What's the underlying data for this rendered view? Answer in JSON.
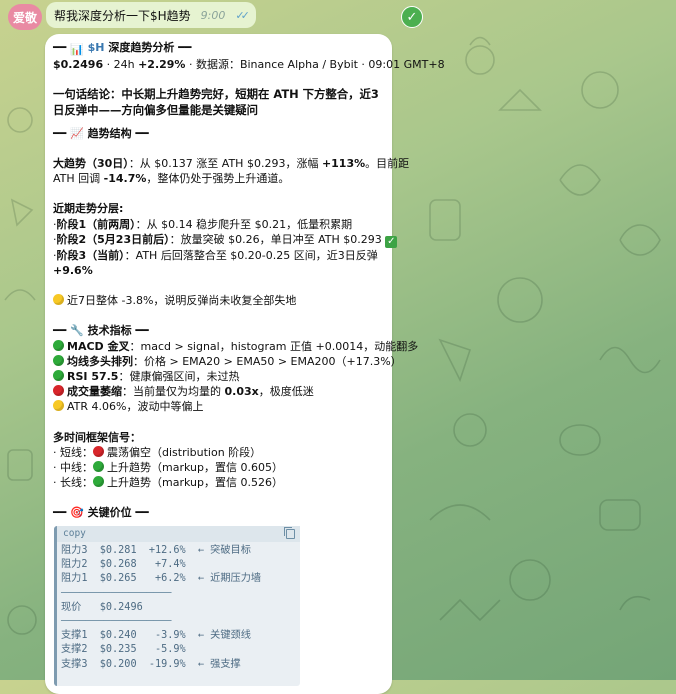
{
  "user_message": {
    "avatar_text": "爱敬",
    "text": "帮我深度分析一下$H趋势",
    "time": "9:00",
    "ticks": "✓✓"
  },
  "bot_message": {
    "title_prefix": "━━ ",
    "title_ticker": "$H",
    "title_text": " 深度趋势分析 ━━",
    "price_line": {
      "price": "$0.2496",
      "rest": " · 24h ",
      "change": "+2.29%",
      "tail": " · 数据源：Binance Alpha / Bybit · 09:01 GMT+8"
    },
    "conclusion": "一句话结论：中长期上升趋势完好，短期在 ATH 下方整合，近3日反弹中——方向偏多但量能是关键疑问",
    "sections": {
      "structure": "━━ 📈 趋势结构 ━━",
      "indicators": "━━ 🔧 技术指标 ━━",
      "key_levels": "━━ 🎯 关键价位 ━━"
    },
    "big_trend": {
      "label": "大趋势（30日）",
      "text1": "：从 $0.137 涨至 ATH $0.293，涨幅 ",
      "pct": "+113%",
      "text2": "。目前距",
      "text3": "ATH 回调 ",
      "pullback": "-14.7%",
      "text4": "，整体仍处于强势上升通道。"
    },
    "recent": {
      "label": "近期走势分层:",
      "stage1_label": "阶段1（前两周）",
      "stage1_text": "：从 $0.14 稳步爬升至 $0.21，低量积累期",
      "stage2_label": "阶段2（5月23日前后）",
      "stage2_text": "：放量突破 $0.26，单日冲至 ATH $0.293",
      "stage3_label": "阶段3（当前）",
      "stage3_text": "：ATH 后回落整合至 $0.20-0.25 区间，近3日反弹",
      "stage3_pct": "+9.6%",
      "bullet": "·"
    },
    "seven_day": "近7日整体 -3.8%，说明反弹尚未收复全部失地",
    "indicators": [
      {
        "color": "green",
        "label": "MACD 金叉",
        "text": "：macd > signal，histogram 正值 +0.0014，动能翻多"
      },
      {
        "color": "green",
        "label": "均线多头排列",
        "text": "：价格 > EMA20 > EMA50 > EMA200（+17.3%）"
      },
      {
        "color": "green",
        "label": "RSI 57.5",
        "text": "：健康偏强区间，未过热"
      },
      {
        "color": "red",
        "label": "成交量萎缩",
        "text": "：当前量仅为均量的 ",
        "bold2": "0.03x",
        "text2": "，极度低迷"
      },
      {
        "color": "yellow",
        "label": "",
        "text": "ATR 4.06%，波动中等偏上"
      }
    ],
    "timeframes": {
      "label": "多时间框架信号：",
      "short": {
        "prefix": "· 短线：",
        "color": "red",
        "text": "震荡偏空（distribution 阶段）"
      },
      "mid": {
        "prefix": "· 中线：",
        "color": "green",
        "text": "上升趋势（markup，置信 0.605）"
      },
      "long": {
        "prefix": "· 长线：",
        "color": "green",
        "text": "上升趋势（markup，置信 0.526）"
      }
    },
    "code_block": {
      "header": "copy",
      "rows": [
        "阻力3  $0.281  +12.6%  ← 突破目标",
        "阻力2  $0.268   +7.4%",
        "阻力1  $0.265   +6.2%  ← 近期压力墙",
        "──────────────────",
        "现价   $0.2496",
        "──────────────────",
        "支撑1  $0.240   -3.9%  ← 关键颈线",
        "支撑2  $0.235   -5.9%",
        "支撑3  $0.200  -19.9%  ← 强支撑"
      ]
    }
  },
  "colors": {
    "ticker_blue": "#3a78b0",
    "bullish_green": "#2eaa3a",
    "bearish_red": "#d8262b",
    "neutral_yellow": "#f7c825",
    "user_bubble": "#e6f3d1"
  }
}
